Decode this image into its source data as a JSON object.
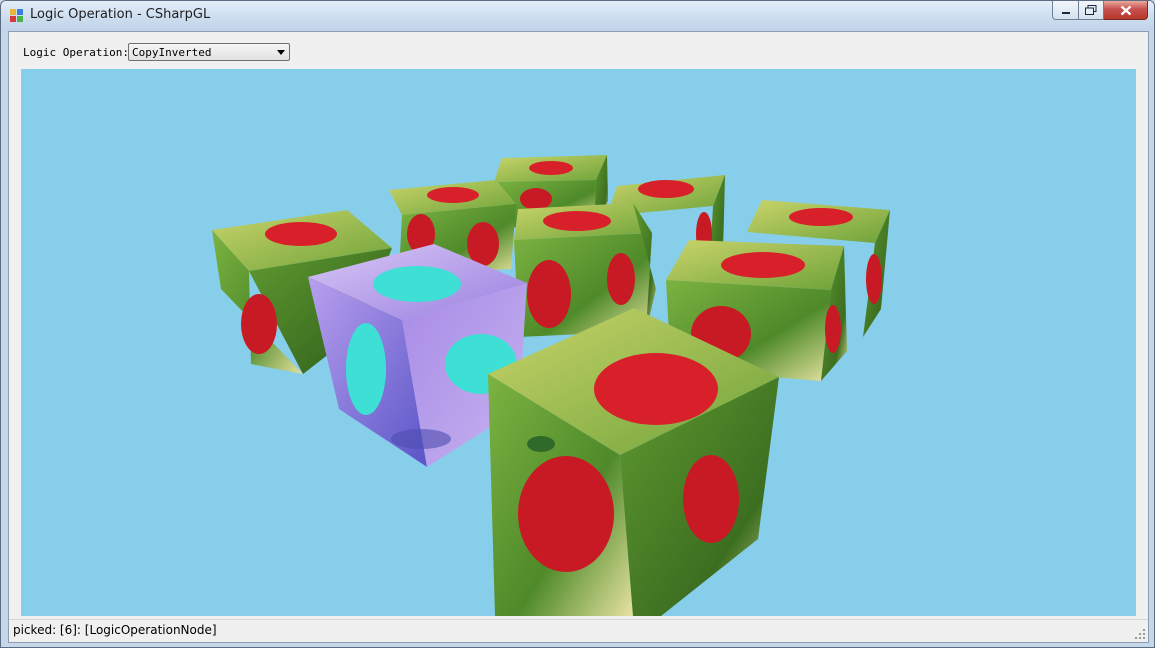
{
  "window": {
    "title": "Logic Operation - CSharpGL",
    "icon": "app-window-icon",
    "buttons": [
      "minimize-icon",
      "maximize-icon",
      "close-icon"
    ]
  },
  "toolbar": {
    "label": "Logic Operation:",
    "selected": "CopyInverted"
  },
  "viewport": {
    "background": "#87ceeb",
    "scene": "3x3 grid of rose-textured cubes, one picked cube rendered in inverted colors"
  },
  "status": {
    "text": "picked: [6]: [LogicOperationNode]"
  },
  "colors": {
    "sky": "#87ceeb",
    "cube_green": "#6aa534",
    "rose_red": "#d8202a",
    "inverted_purple": "#9a7fe0",
    "inverted_cyan": "#3ee0d5"
  }
}
